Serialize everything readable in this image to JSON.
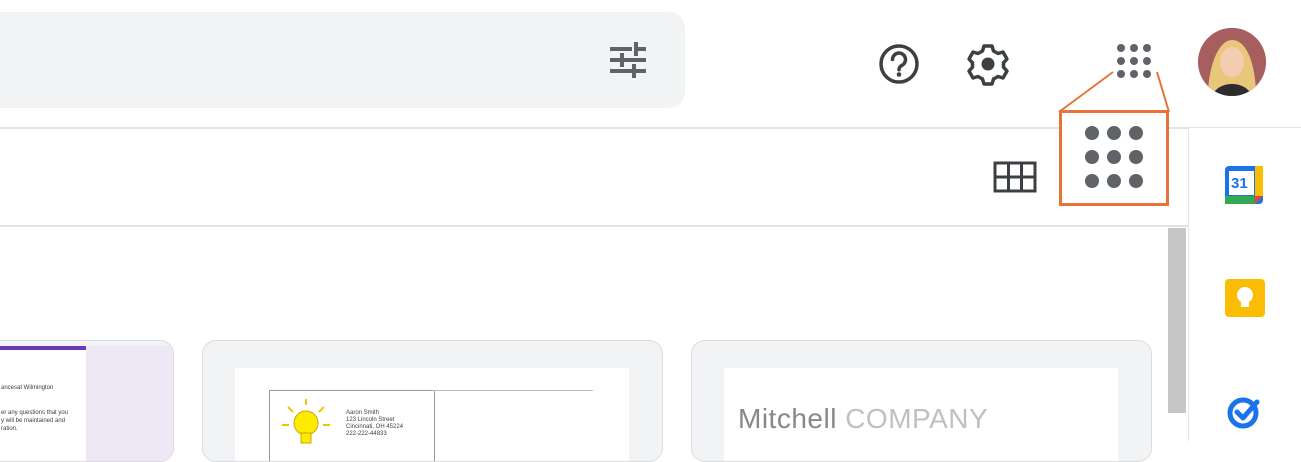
{
  "header": {
    "filter_icon": "tune-icon",
    "help_icon": "help-icon",
    "settings_icon": "gear-icon",
    "apps_icon": "google-apps-icon",
    "avatar": "user-avatar"
  },
  "toolbar": {
    "view_icon": "grid-view-icon"
  },
  "side_panel": {
    "apps": [
      {
        "name": "calendar",
        "label": "31",
        "color": "#1a73e8"
      },
      {
        "name": "keep",
        "color": "#fbbc04"
      },
      {
        "name": "tasks",
        "color": "#1a73e8"
      }
    ]
  },
  "cards": [
    {
      "name": "form-template",
      "lines": [
        "ancesat Wilmington",
        "er any questions that you",
        "y will be maintained and",
        "ration."
      ]
    },
    {
      "name": "letter-template",
      "address": [
        "Aaron Smith",
        "123 Lincoln Street",
        "Cincinnati, OH 45224",
        "222-222-44833"
      ]
    },
    {
      "name": "company-template",
      "title_main": "Mitchell",
      "title_secondary": "COMPANY"
    }
  ],
  "colors": {
    "highlight": "#e8733a",
    "search_bg": "#f1f3f4",
    "form_purple": "#673ab7"
  }
}
